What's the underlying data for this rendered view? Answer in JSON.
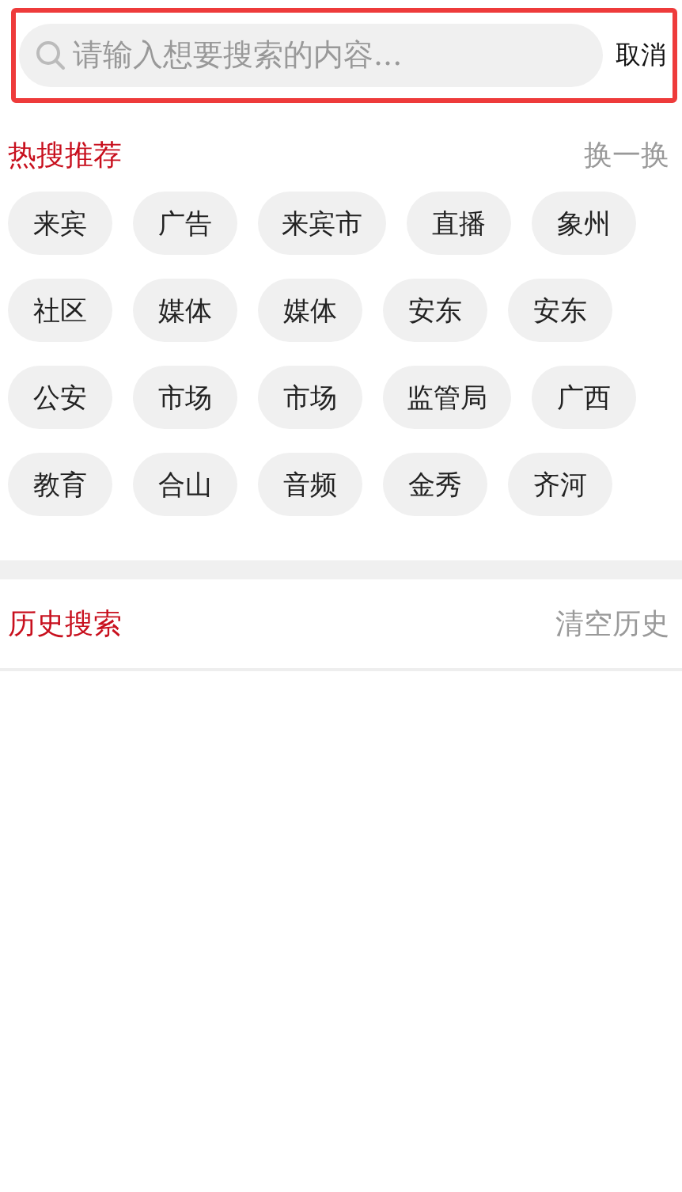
{
  "search": {
    "placeholder": "请输入想要搜索的内容...",
    "cancel": "取消"
  },
  "hot": {
    "title": "热搜推荐",
    "action": "换一换",
    "tags": [
      "来宾",
      "广告",
      "来宾市",
      "直播",
      "象州",
      "社区",
      "媒体",
      "媒体",
      "安东",
      "安东",
      "公安",
      "市场",
      "市场",
      "监管局",
      "广西",
      "教育",
      "合山",
      "音频",
      "金秀",
      "齐河"
    ]
  },
  "history": {
    "title": "历史搜索",
    "action": "清空历史"
  }
}
